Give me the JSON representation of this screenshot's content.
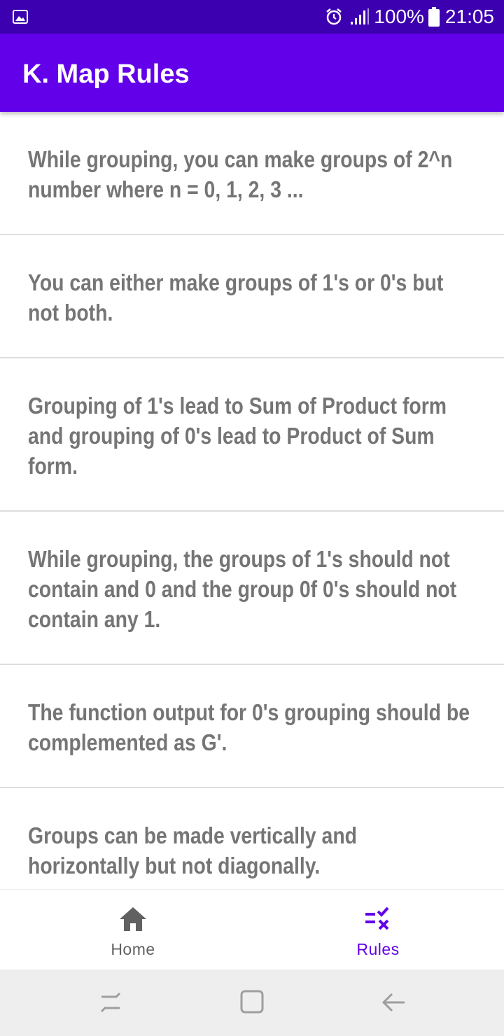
{
  "status_bar": {
    "battery": "100%",
    "time": "21:05",
    "background": "#3d00b0",
    "icons": [
      "gallery-icon",
      "alarm-icon",
      "signal-icon",
      "battery-icon"
    ]
  },
  "app_bar": {
    "title": "K. Map Rules",
    "background": "#6200ea"
  },
  "rules": [
    "While grouping, you can make groups of 2^n number where n = 0, 1, 2, 3 ...",
    "You can either make groups of 1's or 0's but not both.",
    "Grouping of 1's lead to Sum of Product form and grouping of 0's lead to Product of Sum form.",
    "While grouping, the groups of 1's should not contain and 0 and the group 0f 0's should not contain any 1.",
    "The function output for 0's grouping should be complemented as G'.",
    "Groups can be made vertically and horizontally but not diagonally."
  ],
  "bottom_nav": {
    "items": [
      {
        "label": "Home",
        "icon": "home-icon",
        "selected": false
      },
      {
        "label": "Rules",
        "icon": "rules-checklist-icon",
        "selected": true
      }
    ],
    "selected_color": "#6200ea",
    "unselected_color": "#616161"
  },
  "system_nav": {
    "buttons": [
      "recents-icon",
      "home-square-icon",
      "back-arrow-icon"
    ]
  }
}
